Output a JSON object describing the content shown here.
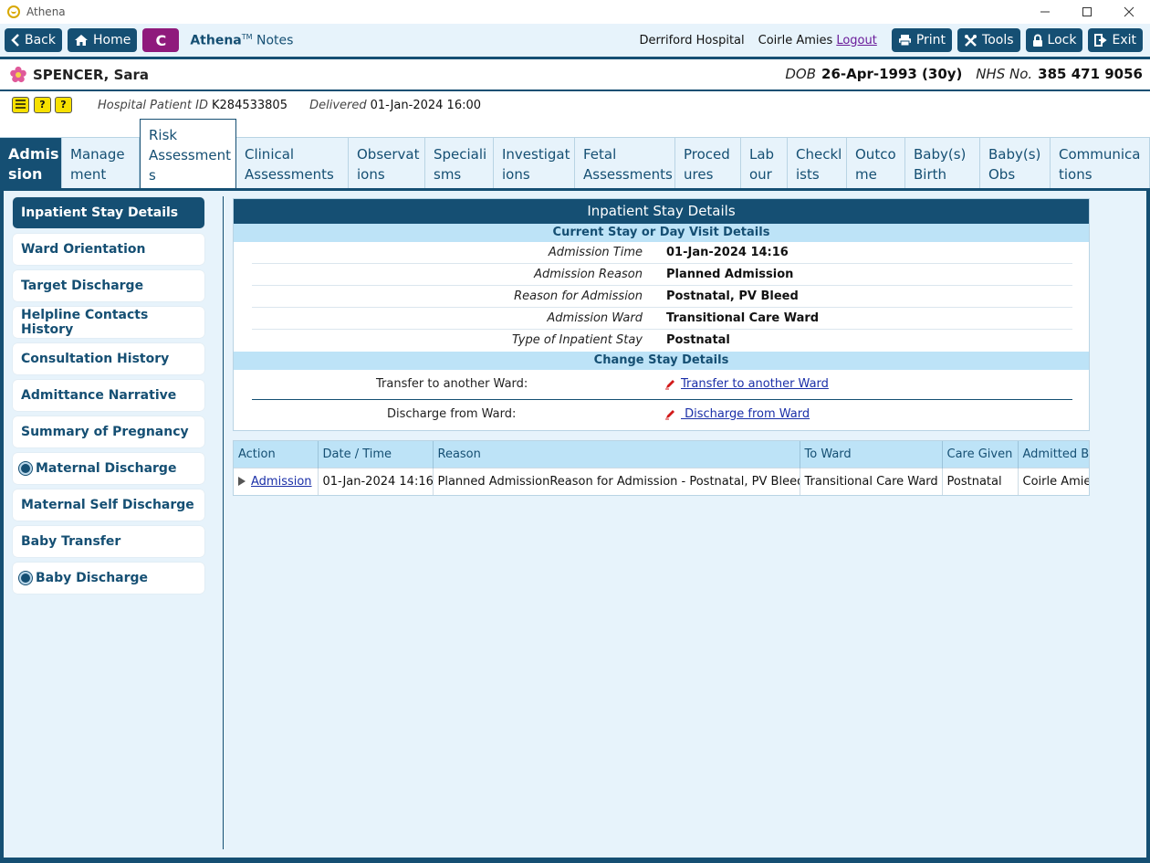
{
  "window": {
    "title": "Athena"
  },
  "toolbar": {
    "back_label": "Back",
    "home_label": "Home",
    "c_label": "C",
    "app_name": "Athena",
    "app_tm": "TM",
    "app_suffix": "Notes",
    "hospital": "Derriford Hospital",
    "user": "Coirle Amies",
    "logout_label": "Logout",
    "print_label": "Print",
    "tools_label": "Tools",
    "lock_label": "Lock",
    "exit_label": "Exit"
  },
  "patient": {
    "name": "SPENCER, Sara",
    "dob_label": "DOB",
    "dob_value": "26-Apr-1993 (30y)",
    "nhs_label": "NHS No.",
    "nhs_value": "385 471 9056",
    "hospital_id_label": "Hospital Patient ID",
    "hospital_id_value": "K284533805",
    "delivered_label": "Delivered",
    "delivered_value": "01-Jan-2024 16:00"
  },
  "tabs": [
    {
      "line1": "Admis",
      "line2": "sion"
    },
    {
      "line1": "Manage",
      "line2": "ment"
    },
    {
      "line1": "Risk",
      "line2": "Assessment",
      "line3": "s"
    },
    {
      "line1": "Clinical",
      "line2": "Assessments"
    },
    {
      "line1": "Observat",
      "line2": "ions"
    },
    {
      "line1": "Speciali",
      "line2": "sms"
    },
    {
      "line1": "Investigat",
      "line2": "ions"
    },
    {
      "line1": "Fetal",
      "line2": "Assessments"
    },
    {
      "line1": "Proced",
      "line2": "ures"
    },
    {
      "line1": "Lab",
      "line2": "our"
    },
    {
      "line1": "Checkl",
      "line2": "ists"
    },
    {
      "line1": "Outco",
      "line2": "me"
    },
    {
      "line1": "Baby(s)",
      "line2": "Birth"
    },
    {
      "line1": "Baby(s)",
      "line2": "Obs"
    },
    {
      "line1": "Communica",
      "line2": "tions"
    }
  ],
  "sidebar": {
    "items": [
      {
        "label": "Inpatient Stay Details"
      },
      {
        "label": "Ward Orientation"
      },
      {
        "label": "Target Discharge"
      },
      {
        "label": "Helpline Contacts History"
      },
      {
        "label": "Consultation History"
      },
      {
        "label": "Admittance Narrative"
      },
      {
        "label": "Summary of Pregnancy"
      },
      {
        "label": "Maternal Discharge"
      },
      {
        "label": "Maternal Self Discharge"
      },
      {
        "label": "Baby Transfer"
      },
      {
        "label": "Baby Discharge"
      }
    ]
  },
  "details": {
    "title": "Inpatient Stay Details",
    "current_section": "Current Stay or Day Visit Details",
    "rows": [
      {
        "label": "Admission Time",
        "value": "01-Jan-2024 14:16"
      },
      {
        "label": "Admission Reason",
        "value": "Planned Admission"
      },
      {
        "label": "Reason for Admission",
        "value": "Postnatal, PV Bleed"
      },
      {
        "label": "Admission Ward",
        "value": "Transitional Care Ward"
      },
      {
        "label": "Type of Inpatient Stay",
        "value": "Postnatal"
      }
    ],
    "change_section": "Change Stay Details",
    "transfer_label": "Transfer to another Ward:",
    "transfer_link": "Transfer to another Ward",
    "discharge_label": "Discharge from Ward:",
    "discharge_link": " Discharge from Ward"
  },
  "history": {
    "columns": [
      "Action",
      "Date / Time",
      "Reason",
      "To Ward",
      "Care Given",
      "Admitted By"
    ],
    "rows": [
      {
        "action": "Admission",
        "datetime": "01-Jan-2024 14:16",
        "reason": "Planned AdmissionReason for Admission - Postnatal, PV Bleed",
        "to_ward": "Transitional Care Ward",
        "care_given": "Postnatal",
        "admitted_by": "Coirle Amies"
      }
    ]
  },
  "colors": {
    "primary": "#154f73",
    "light": "#e7f3fb",
    "section": "#bde3f7",
    "accent_c": "#8f1a7c",
    "alert": "#f7e000"
  }
}
